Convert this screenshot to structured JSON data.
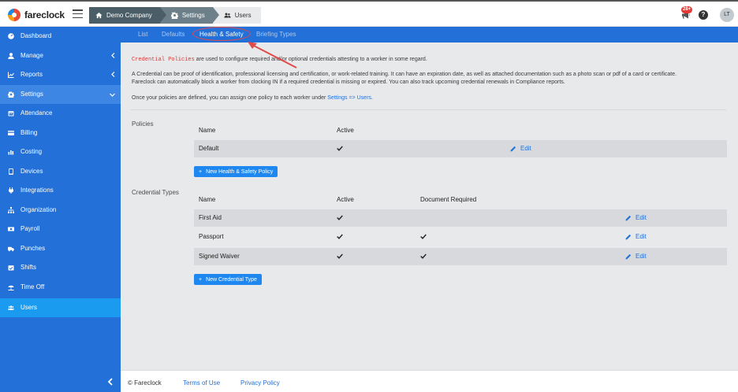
{
  "app": {
    "logo_text": "fareclock"
  },
  "breadcrumb": {
    "items": [
      {
        "label": "Demo Company",
        "icon": "home-icon"
      },
      {
        "label": "Settings",
        "icon": "gear-icon"
      },
      {
        "label": "Users",
        "icon": "users-icon"
      }
    ]
  },
  "header": {
    "notif_count": "28+",
    "help_label": "?",
    "avatar_initials": "LT"
  },
  "sidebar": {
    "items": [
      {
        "label": "Dashboard",
        "icon": "dashboard-icon"
      },
      {
        "label": "Manage",
        "icon": "user-icon",
        "chevron": "chevron-left-icon"
      },
      {
        "label": "Reports",
        "icon": "chart-icon",
        "chevron": "chevron-left-icon"
      },
      {
        "label": "Settings",
        "icon": "gear-icon",
        "chevron": "chevron-down-icon",
        "expanded": true
      },
      {
        "label": "Attendance",
        "icon": "calendar-icon"
      },
      {
        "label": "Billing",
        "icon": "credit-card-icon"
      },
      {
        "label": "Costing",
        "icon": "bar-chart-icon"
      },
      {
        "label": "Devices",
        "icon": "tablet-icon"
      },
      {
        "label": "Integrations",
        "icon": "plug-icon"
      },
      {
        "label": "Organization",
        "icon": "sitemap-icon"
      },
      {
        "label": "Payroll",
        "icon": "money-icon"
      },
      {
        "label": "Punches",
        "icon": "truck-icon"
      },
      {
        "label": "Shifts",
        "icon": "calendar-check-icon"
      },
      {
        "label": "Time Off",
        "icon": "umbrella-beach-icon"
      },
      {
        "label": "Users",
        "icon": "users-icon",
        "active": true
      }
    ]
  },
  "tabs": [
    {
      "label": "List"
    },
    {
      "label": "Defaults"
    },
    {
      "label": "Health & Safety",
      "active": true
    },
    {
      "label": "Briefing Types"
    }
  ],
  "intro": {
    "code_term": "Credential Policies",
    "line1_rest": " are used to configure required and/or optional credentials attesting to a worker in some regard.",
    "line2": "A Credential can be proof of identification, professional licensing and certification, or work-related training. It can have an expiration date, as well as attached documentation such as a photo scan or pdf of a card or certificate.",
    "line3": "Fareclock can automatically block a worker from clocking IN if a required credential is missing or expired. You can also track upcoming credential renewals in Compliance reports.",
    "line4_pre": "Once your policies are defined, you can assign one policy to each worker under ",
    "line4_link": "Settings => Users",
    "line4_post": "."
  },
  "policies": {
    "section_label": "Policies",
    "columns": {
      "name": "Name",
      "active": "Active"
    },
    "rows": [
      {
        "name": "Default",
        "active": true,
        "edit_label": "Edit"
      }
    ],
    "new_button": "New Health & Safety Policy"
  },
  "credential_types": {
    "section_label": "Credential Types",
    "columns": {
      "name": "Name",
      "active": "Active",
      "document_required": "Document Required"
    },
    "rows": [
      {
        "name": "First Aid",
        "active": true,
        "document_required": false,
        "edit_label": "Edit"
      },
      {
        "name": "Passport",
        "active": true,
        "document_required": true,
        "edit_label": "Edit"
      },
      {
        "name": "Signed Waiver",
        "active": true,
        "document_required": true,
        "edit_label": "Edit"
      }
    ],
    "new_button": "New Credential Type"
  },
  "footer": {
    "copyright": "© Fareclock",
    "terms": "Terms of Use",
    "privacy": "Privacy Policy"
  },
  "colors": {
    "brand_blue": "#2270d8",
    "active_item": "#1a9bf0",
    "annotation_red": "#e04a4a"
  }
}
